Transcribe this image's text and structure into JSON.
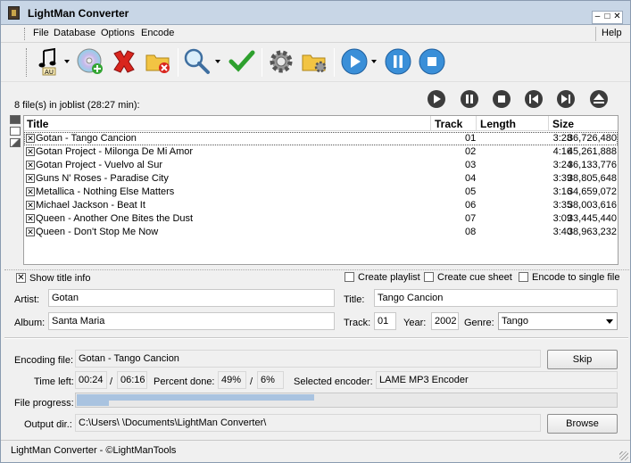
{
  "window": {
    "title": "LightMan Converter",
    "buttons": [
      "–",
      "□",
      "✕"
    ]
  },
  "menu": {
    "items": [
      "File",
      "Database",
      "Options",
      "Encode"
    ],
    "help": "Help"
  },
  "toolbar": {
    "buttons": [
      "add-audio",
      "add-cd",
      "remove",
      "clear-folder",
      "search",
      "check",
      "settings",
      "folder-settings",
      "play",
      "pause",
      "stop"
    ]
  },
  "joblist": {
    "summary": "8 file(s) in joblist (28:27 min):"
  },
  "list": {
    "headers": {
      "title": "Title",
      "track": "Track",
      "length": "Length",
      "size": "Size"
    },
    "rows": [
      {
        "title": "Gotan  - Tango Cancion",
        "track": "01",
        "length": "3:28",
        "size": "36,726,480"
      },
      {
        "title": "Gotan Project - Milonga De Mi Amor",
        "track": "02",
        "length": "4:16",
        "size": "45,261,888"
      },
      {
        "title": "Gotan Project - Vuelvo al Sur",
        "track": "03",
        "length": "3:24",
        "size": "36,133,776"
      },
      {
        "title": "Guns N' Roses - Paradise City",
        "track": "04",
        "length": "3:39",
        "size": "38,805,648"
      },
      {
        "title": "Metallica - Nothing Else Matters",
        "track": "05",
        "length": "3:16",
        "size": "34,659,072"
      },
      {
        "title": "Michael Jackson - Beat It",
        "track": "06",
        "length": "3:35",
        "size": "38,003,616"
      },
      {
        "title": "Queen - Another One Bites the Dust",
        "track": "07",
        "length": "3:09",
        "size": "33,445,440"
      },
      {
        "title": "Queen - Don't Stop Me Now",
        "track": "08",
        "length": "3:40",
        "size": "38,963,232"
      }
    ]
  },
  "options": {
    "show_title_info": "Show title info",
    "create_playlist": "Create playlist",
    "create_cue_sheet": "Create cue sheet",
    "encode_single": "Encode to single file"
  },
  "info": {
    "artist_label": "Artist:",
    "artist": "Gotan",
    "title_label": "Title:",
    "title": "Tango Cancion",
    "album_label": "Album:",
    "album": "Santa Maria",
    "track_label": "Track:",
    "track": "01",
    "year_label": "Year:",
    "year": "2002",
    "genre_label": "Genre:",
    "genre": "Tango"
  },
  "encoding": {
    "file_label": "Encoding file:",
    "file": "Gotan  - Tango Cancion",
    "skip": "Skip",
    "time_left_label": "Time left:",
    "time_left": "00:24",
    "slash1": "/",
    "time_total": "06:16",
    "percent_label": "Percent done:",
    "percent": "49%",
    "slash2": "/",
    "percent_total": "6%",
    "encoder_label": "Selected encoder:",
    "encoder": "LAME MP3 Encoder",
    "progress_label": "File progress:",
    "file_progress": 0.44,
    "total_progress": 0.06,
    "output_label": "Output dir.:",
    "output": "C:\\Users\\        \\Documents\\LightMan Converter\\",
    "browse": "Browse"
  },
  "status": {
    "text": "LightMan Converter  - ©LightManTools"
  }
}
